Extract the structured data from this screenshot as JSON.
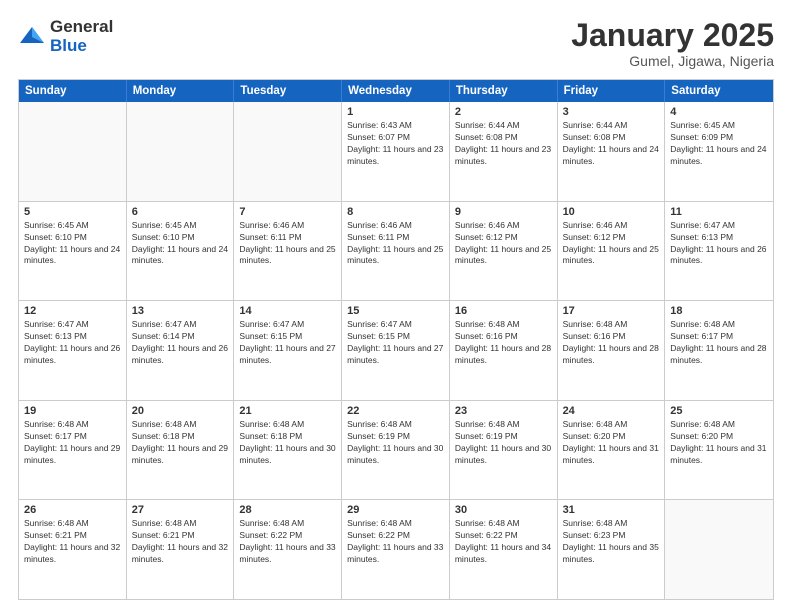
{
  "logo": {
    "general": "General",
    "blue": "Blue"
  },
  "title": {
    "month": "January 2025",
    "location": "Gumel, Jigawa, Nigeria"
  },
  "days_of_week": [
    "Sunday",
    "Monday",
    "Tuesday",
    "Wednesday",
    "Thursday",
    "Friday",
    "Saturday"
  ],
  "weeks": [
    [
      {
        "day": "",
        "sunrise": "",
        "sunset": "",
        "daylight": ""
      },
      {
        "day": "",
        "sunrise": "",
        "sunset": "",
        "daylight": ""
      },
      {
        "day": "",
        "sunrise": "",
        "sunset": "",
        "daylight": ""
      },
      {
        "day": "1",
        "sunrise": "Sunrise: 6:43 AM",
        "sunset": "Sunset: 6:07 PM",
        "daylight": "Daylight: 11 hours and 23 minutes."
      },
      {
        "day": "2",
        "sunrise": "Sunrise: 6:44 AM",
        "sunset": "Sunset: 6:08 PM",
        "daylight": "Daylight: 11 hours and 23 minutes."
      },
      {
        "day": "3",
        "sunrise": "Sunrise: 6:44 AM",
        "sunset": "Sunset: 6:08 PM",
        "daylight": "Daylight: 11 hours and 24 minutes."
      },
      {
        "day": "4",
        "sunrise": "Sunrise: 6:45 AM",
        "sunset": "Sunset: 6:09 PM",
        "daylight": "Daylight: 11 hours and 24 minutes."
      }
    ],
    [
      {
        "day": "5",
        "sunrise": "Sunrise: 6:45 AM",
        "sunset": "Sunset: 6:10 PM",
        "daylight": "Daylight: 11 hours and 24 minutes."
      },
      {
        "day": "6",
        "sunrise": "Sunrise: 6:45 AM",
        "sunset": "Sunset: 6:10 PM",
        "daylight": "Daylight: 11 hours and 24 minutes."
      },
      {
        "day": "7",
        "sunrise": "Sunrise: 6:46 AM",
        "sunset": "Sunset: 6:11 PM",
        "daylight": "Daylight: 11 hours and 25 minutes."
      },
      {
        "day": "8",
        "sunrise": "Sunrise: 6:46 AM",
        "sunset": "Sunset: 6:11 PM",
        "daylight": "Daylight: 11 hours and 25 minutes."
      },
      {
        "day": "9",
        "sunrise": "Sunrise: 6:46 AM",
        "sunset": "Sunset: 6:12 PM",
        "daylight": "Daylight: 11 hours and 25 minutes."
      },
      {
        "day": "10",
        "sunrise": "Sunrise: 6:46 AM",
        "sunset": "Sunset: 6:12 PM",
        "daylight": "Daylight: 11 hours and 25 minutes."
      },
      {
        "day": "11",
        "sunrise": "Sunrise: 6:47 AM",
        "sunset": "Sunset: 6:13 PM",
        "daylight": "Daylight: 11 hours and 26 minutes."
      }
    ],
    [
      {
        "day": "12",
        "sunrise": "Sunrise: 6:47 AM",
        "sunset": "Sunset: 6:13 PM",
        "daylight": "Daylight: 11 hours and 26 minutes."
      },
      {
        "day": "13",
        "sunrise": "Sunrise: 6:47 AM",
        "sunset": "Sunset: 6:14 PM",
        "daylight": "Daylight: 11 hours and 26 minutes."
      },
      {
        "day": "14",
        "sunrise": "Sunrise: 6:47 AM",
        "sunset": "Sunset: 6:15 PM",
        "daylight": "Daylight: 11 hours and 27 minutes."
      },
      {
        "day": "15",
        "sunrise": "Sunrise: 6:47 AM",
        "sunset": "Sunset: 6:15 PM",
        "daylight": "Daylight: 11 hours and 27 minutes."
      },
      {
        "day": "16",
        "sunrise": "Sunrise: 6:48 AM",
        "sunset": "Sunset: 6:16 PM",
        "daylight": "Daylight: 11 hours and 28 minutes."
      },
      {
        "day": "17",
        "sunrise": "Sunrise: 6:48 AM",
        "sunset": "Sunset: 6:16 PM",
        "daylight": "Daylight: 11 hours and 28 minutes."
      },
      {
        "day": "18",
        "sunrise": "Sunrise: 6:48 AM",
        "sunset": "Sunset: 6:17 PM",
        "daylight": "Daylight: 11 hours and 28 minutes."
      }
    ],
    [
      {
        "day": "19",
        "sunrise": "Sunrise: 6:48 AM",
        "sunset": "Sunset: 6:17 PM",
        "daylight": "Daylight: 11 hours and 29 minutes."
      },
      {
        "day": "20",
        "sunrise": "Sunrise: 6:48 AM",
        "sunset": "Sunset: 6:18 PM",
        "daylight": "Daylight: 11 hours and 29 minutes."
      },
      {
        "day": "21",
        "sunrise": "Sunrise: 6:48 AM",
        "sunset": "Sunset: 6:18 PM",
        "daylight": "Daylight: 11 hours and 30 minutes."
      },
      {
        "day": "22",
        "sunrise": "Sunrise: 6:48 AM",
        "sunset": "Sunset: 6:19 PM",
        "daylight": "Daylight: 11 hours and 30 minutes."
      },
      {
        "day": "23",
        "sunrise": "Sunrise: 6:48 AM",
        "sunset": "Sunset: 6:19 PM",
        "daylight": "Daylight: 11 hours and 30 minutes."
      },
      {
        "day": "24",
        "sunrise": "Sunrise: 6:48 AM",
        "sunset": "Sunset: 6:20 PM",
        "daylight": "Daylight: 11 hours and 31 minutes."
      },
      {
        "day": "25",
        "sunrise": "Sunrise: 6:48 AM",
        "sunset": "Sunset: 6:20 PM",
        "daylight": "Daylight: 11 hours and 31 minutes."
      }
    ],
    [
      {
        "day": "26",
        "sunrise": "Sunrise: 6:48 AM",
        "sunset": "Sunset: 6:21 PM",
        "daylight": "Daylight: 11 hours and 32 minutes."
      },
      {
        "day": "27",
        "sunrise": "Sunrise: 6:48 AM",
        "sunset": "Sunset: 6:21 PM",
        "daylight": "Daylight: 11 hours and 32 minutes."
      },
      {
        "day": "28",
        "sunrise": "Sunrise: 6:48 AM",
        "sunset": "Sunset: 6:22 PM",
        "daylight": "Daylight: 11 hours and 33 minutes."
      },
      {
        "day": "29",
        "sunrise": "Sunrise: 6:48 AM",
        "sunset": "Sunset: 6:22 PM",
        "daylight": "Daylight: 11 hours and 33 minutes."
      },
      {
        "day": "30",
        "sunrise": "Sunrise: 6:48 AM",
        "sunset": "Sunset: 6:22 PM",
        "daylight": "Daylight: 11 hours and 34 minutes."
      },
      {
        "day": "31",
        "sunrise": "Sunrise: 6:48 AM",
        "sunset": "Sunset: 6:23 PM",
        "daylight": "Daylight: 11 hours and 35 minutes."
      },
      {
        "day": "",
        "sunrise": "",
        "sunset": "",
        "daylight": ""
      }
    ]
  ]
}
